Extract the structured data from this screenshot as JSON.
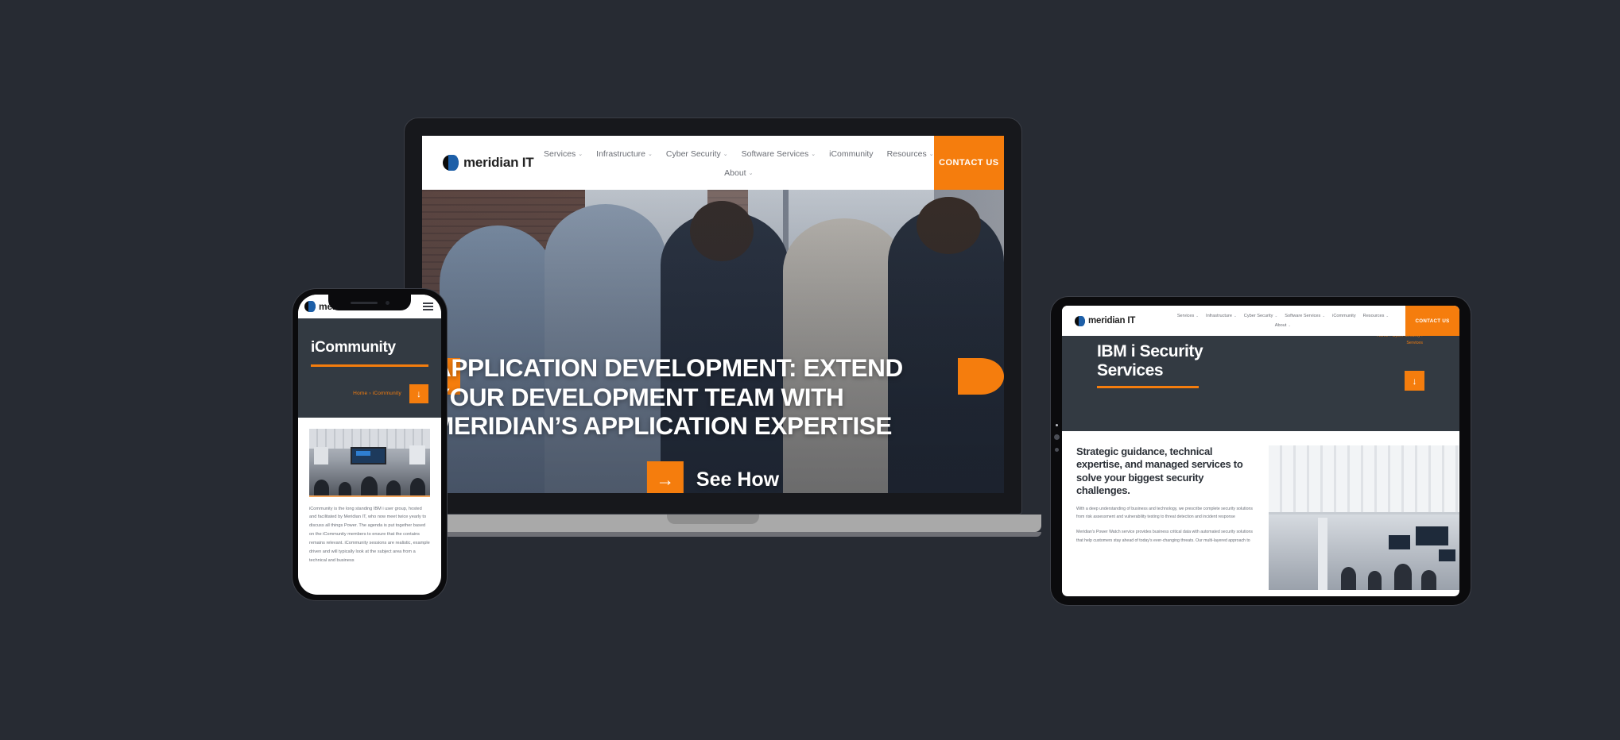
{
  "page": {
    "background_color": "#272b33",
    "accent_color": "#f57d0d",
    "dark_panel_color": "#333a42"
  },
  "brand": {
    "name": "meridian IT",
    "logo_icon": "meridian-circle-logo"
  },
  "nav": {
    "row1": [
      {
        "label": "Services",
        "has_dropdown": true
      },
      {
        "label": "Infrastructure",
        "has_dropdown": true
      },
      {
        "label": "Cyber Security",
        "has_dropdown": true
      },
      {
        "label": "Software Services",
        "has_dropdown": true
      },
      {
        "label": "iCommunity",
        "has_dropdown": false
      },
      {
        "label": "Resources",
        "has_dropdown": true
      }
    ],
    "row2": [
      {
        "label": "About",
        "has_dropdown": true
      }
    ],
    "cta_label": "CONTACT US",
    "caret_glyph": "⌄"
  },
  "laptop": {
    "hero": {
      "headline_line1": "APPLICATION DEVELOPMENT: EXTEND",
      "headline_line2": "YOUR DEVELOPMENT TEAM WITH",
      "headline_line3": "MERIDIAN’S APPLICATION EXPERTISE",
      "cta_label": "See How",
      "cta_icon": "arrow-right-icon",
      "arrow_glyph": "→",
      "carousel_dots": 5,
      "active_dot_index": 2
    }
  },
  "phone": {
    "menu_icon": "hamburger-menu-icon",
    "hero_title": "iCommunity",
    "breadcrumb": "Home › iCommunity",
    "scroll_icon": "arrow-down-icon",
    "arrow_down_glyph": "↓",
    "image_alt": "conference-room-presentation-photo",
    "body_text": "iCommunity is the long standing IBM i user group, hosted and facilitated by Meridian IT, who now meet twice yearly to discuss all things Power. The agenda is put together based on the iCommunity members to ensure that the contains remains relevant. iCommunity sessions are realistic, example driven and will typically look at the subject area from a technical and business"
  },
  "tablet": {
    "hero_title_line1": "IBM i Security",
    "hero_title_line2": "Services",
    "breadcrumb_line1": "Home › Cyber Security ›",
    "breadcrumb_line2": "Services",
    "scroll_icon": "arrow-down-icon",
    "arrow_down_glyph": "↓",
    "heading": "Strategic guidance, technical expertise, and managed services to solve your biggest security challenges.",
    "paragraph1": "With a deep understanding of business and technology, we prescribe complete security solutions from risk assessment and vulnerability testing to threat detection and incident response",
    "paragraph2": "Meridian's Power Watch service provides business critical data with automated security solutions that help customers stay ahead of today's ever-changing threats. Our multi-layered approach to",
    "image_alt": "open-plan-office-photo"
  }
}
